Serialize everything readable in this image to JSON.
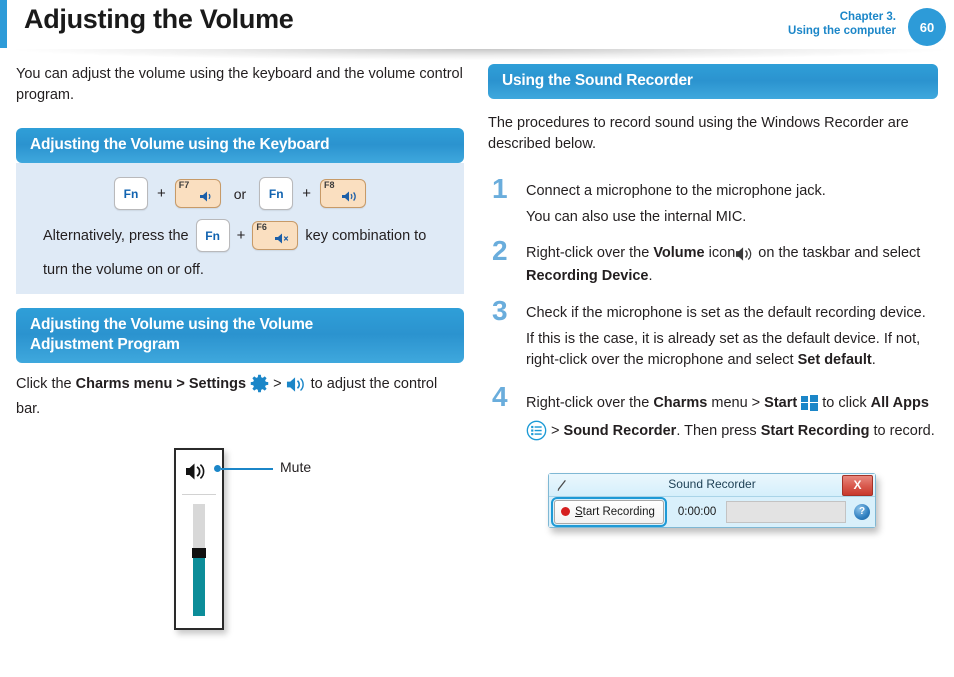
{
  "header": {
    "title": "Adjusting the Volume",
    "chapter_line1": "Chapter 3.",
    "chapter_line2": "Using the computer",
    "page_number": "60",
    "accent_color": "#2d9bd8"
  },
  "left": {
    "intro": "You can adjust the volume using the keyboard and the volume control program.",
    "section1_title": "Adjusting the Volume using the Keyboard",
    "keys": {
      "fn_label": "Fn",
      "plus": "+",
      "or": "or",
      "f7_label": "F7",
      "f7_icon": "volume-down-icon",
      "f8_label": "F8",
      "f8_icon": "volume-up-icon",
      "f6_label": "F6",
      "f6_icon": "volume-mute-icon"
    },
    "alt_text_before": "Alternatively, press the",
    "alt_text_after": "key combination to",
    "alt_text_line2": "turn the volume on or off.",
    "section2_title_line1": "Adjusting the Volume using the Volume",
    "section2_title_line2": "Adjustment Program",
    "charms": {
      "prefix": "Click the",
      "bold1": "Charms menu > Settings",
      "gt1": ">",
      "gear_icon": "gear-icon",
      "gt2": ">",
      "speaker_icon": "speaker-icon",
      "suffix": "to adjust the control bar."
    },
    "volume_widget": {
      "speaker_icon": "speaker-icon",
      "callout_label": "Mute",
      "fill_percent": 55
    }
  },
  "right": {
    "section_title": "Using the Sound Recorder",
    "intro": "The procedures to record sound using the Windows Recorder are described below.",
    "steps": [
      {
        "number": "1",
        "text": "Connect a microphone to the microphone jack.",
        "sub": "You can also use the internal MIC."
      },
      {
        "number": "2",
        "text_part1": "Right-click over the",
        "bold1": "Volume",
        "text_part2": "icon",
        "speaker_icon": "speaker-icon",
        "text_part3": "on the taskbar and select",
        "bold2": "Recording Device",
        "text_part4": "."
      },
      {
        "number": "3",
        "text": "Check if the microphone is set as the default recording device.",
        "sub_part1": "If this is the case, it is already set as the default device. If not, right-click over the microphone and select",
        "sub_bold": "Set default",
        "sub_part2": "."
      },
      {
        "number": "4",
        "text_part1": "Right-click over the",
        "bold1": "Charms",
        "text_part2": "menu >",
        "bold2": "Start",
        "windows_icon": "windows-logo-icon",
        "text_part3": "to click",
        "bold3": "All Apps",
        "allapps_icon": "all-apps-icon",
        "text_part4": ">",
        "bold4": "Sound Recorder",
        "text_part5": ". Then press",
        "bold5": "Start Recording",
        "text_part6": "to record."
      }
    ],
    "recorder_dialog": {
      "app_icon": "microphone-icon",
      "title": "Sound Recorder",
      "close_label": "X",
      "record_dot": "record-dot-icon",
      "button_accel": "S",
      "button_label": "tart Recording",
      "timer": "0:00:00",
      "help_label": "?"
    }
  },
  "colors": {
    "section_blue": "#2f9fd8",
    "panel_blue": "#dfeaf6",
    "step_number": "#6aaddc",
    "key_orange": "#fadfc0",
    "slider_teal": "#0c8d99"
  }
}
